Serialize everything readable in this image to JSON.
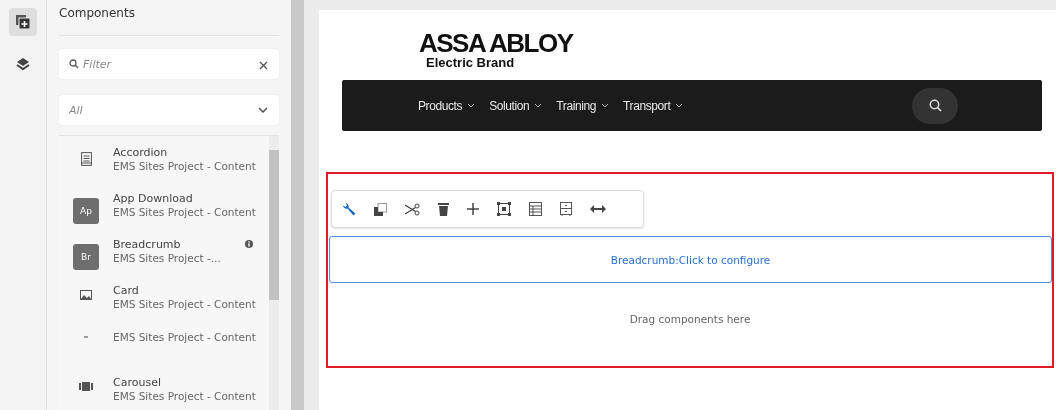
{
  "rail": [
    {
      "kind": "components",
      "selected": true
    },
    {
      "kind": "layers",
      "selected": false
    }
  ],
  "panel": {
    "title": "Components",
    "filter": {
      "placeholder": "Filter"
    },
    "group_select": {
      "placeholder": "All"
    },
    "items": [
      {
        "kind": "lines",
        "title": "Accordion",
        "subtitle": "EMS Sites Project - Content",
        "info": false
      },
      {
        "kind": "badge",
        "badge": "Ap",
        "title": "App Download",
        "subtitle": "EMS Sites Project - Content",
        "info": false
      },
      {
        "kind": "badge",
        "badge": "Br",
        "title": "Breadcrumb",
        "subtitle": "EMS Sites Project -...",
        "info": true
      },
      {
        "kind": "image",
        "title": "Card",
        "subtitle": "EMS Sites Project - Content",
        "info": false
      },
      {
        "kind": "dot",
        "subtitle": "EMS Sites Project - Content",
        "info": false
      },
      {
        "kind": "carousel",
        "title": "Carousel",
        "subtitle": "EMS Sites Project - Content",
        "info": false
      }
    ]
  },
  "page": {
    "logo": "ASSA ABLOY",
    "logo_sub": "Electric Brand",
    "nav": [
      "Products",
      "Solution",
      "Training",
      "Transport"
    ],
    "toolbar": [
      {
        "kind": "configure"
      },
      {
        "kind": "copy"
      },
      {
        "kind": "cut"
      },
      {
        "kind": "delete"
      },
      {
        "kind": "insert"
      },
      {
        "kind": "group"
      },
      {
        "kind": "policy"
      },
      {
        "kind": "layout"
      },
      {
        "kind": "width"
      }
    ],
    "breadcrumb_placeholder": "Breadcrumb:Click to configure",
    "drop_hint": "Drag components here"
  }
}
